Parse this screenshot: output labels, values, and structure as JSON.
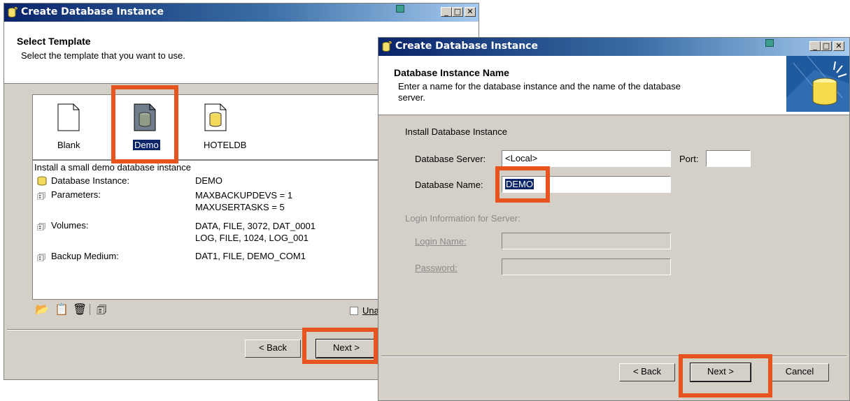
{
  "window1": {
    "title": "Create Database Instance",
    "header_title": "Select Template",
    "header_subtitle": "Select the template that you want to use.",
    "templates": [
      {
        "label": "Blank",
        "icon": "blank-template-icon"
      },
      {
        "label": "Demo",
        "icon": "demo-database-icon",
        "selected": true
      },
      {
        "label": "HOTELDB",
        "icon": "database-icon"
      }
    ],
    "description": "Install a small demo database instance",
    "details": [
      {
        "icon": "database-icon",
        "name": "Database Instance:",
        "value": "DEMO"
      },
      {
        "icon": "properties-icon",
        "name": "Parameters:",
        "value": "MAXBACKUPDEVS = 1\nMAXUSERTASKS = 5"
      },
      {
        "icon": "properties-icon",
        "name": "Volumes:",
        "value": "DATA, FILE, 3072, DAT_0001\nLOG, FILE, 1024, LOG_001"
      },
      {
        "icon": "properties-icon",
        "name": "Backup Medium:",
        "value": "DAT1, FILE, DEMO_COM1"
      }
    ],
    "toolbar_icons": [
      "open-folder-icon",
      "copy-icon",
      "delete-icon",
      "properties-icon"
    ],
    "checkbox_label": "Una",
    "back_label": "< Back",
    "next_label": "Next >"
  },
  "window2": {
    "title": "Create Database Instance",
    "header_title": "Database Instance Name",
    "header_subtitle": "Enter a name for the database instance and the name of the database\nserver.",
    "group_label": "Install Database Instance",
    "server_label": "Database Server:",
    "server_value": "<Local>",
    "port_label": "Port:",
    "port_value": "",
    "name_label": "Database Name:",
    "name_value": "DEMO",
    "login_group_label": "Login Information for Server:",
    "login_name_label": "Login Name:",
    "password_label": "Password:",
    "back_label": "< Back",
    "next_label": "Next >",
    "cancel_label": "Cancel"
  },
  "colors": {
    "highlight": "#e8541e",
    "titlebar_start": "#0a246a",
    "titlebar_end": "#a6caf0",
    "dialog_bg": "#d4d0c8"
  }
}
